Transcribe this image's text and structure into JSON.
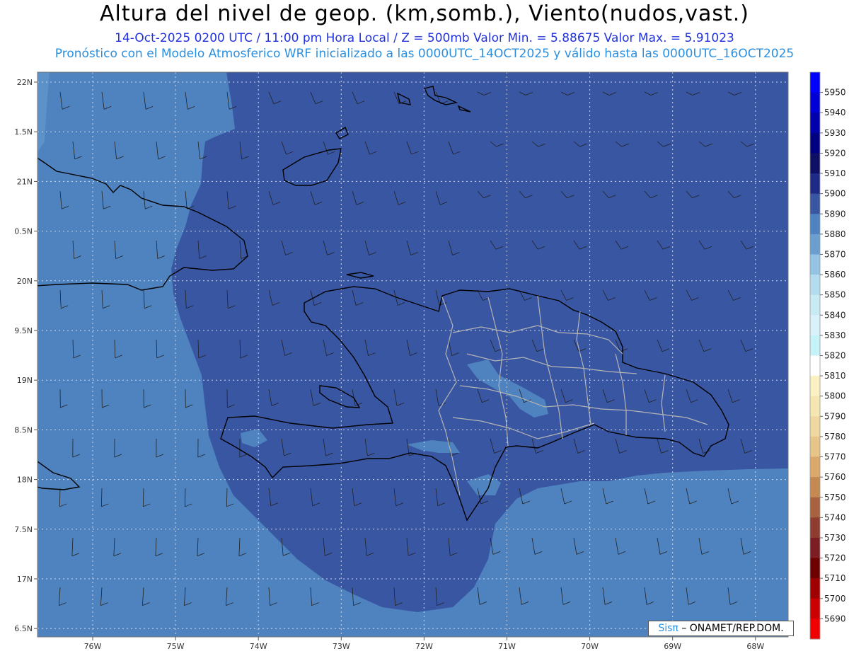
{
  "header": {
    "title": "Altura del nivel de geop. (km,somb.), Viento(nudos,vast.)",
    "line1": "14-Oct-2025  0200 UTC / 11:00 pm Hora Local / Z = 500mb     Valor Min. = 5.88675   Valor Max. = 5.91023",
    "line2": "Pronóstico con el Modelo Atmosferico WRF inicializado a las 0000UTC_14OCT2025 y válido hasta las  0000UTC_16OCT2025"
  },
  "map": {
    "lat_labels": [
      "22N",
      "1.5N",
      "21N",
      "0.5N",
      "20N",
      "9.5N",
      "19N",
      "8.5N",
      "18N",
      "7.5N",
      "17N",
      "6.5N"
    ],
    "lon_labels": [
      "76W",
      "75W",
      "74W",
      "73W",
      "72W",
      "71W",
      "70W",
      "69W",
      "68W"
    ],
    "colors": {
      "band_5890": "#4f83bf",
      "band_5900": "#3956a3",
      "band_5880": "#6a9fd0",
      "coast": "#000000",
      "provinces": "#b4b4b4",
      "grid": "#cfd6e8"
    }
  },
  "colorbar": {
    "levels": [
      "5950",
      "5940",
      "5930",
      "5920",
      "5910",
      "5900",
      "5890",
      "5880",
      "5870",
      "5860",
      "5850",
      "5840",
      "5830",
      "5820",
      "5810",
      "5800",
      "5790",
      "5780",
      "5770",
      "5760",
      "5750",
      "5740",
      "5730",
      "5720",
      "5710",
      "5700",
      "5690"
    ],
    "colors": [
      "#0000ff",
      "#0000d6",
      "#0000ac",
      "#000082",
      "#0f0f66",
      "#1d2b86",
      "#3956a3",
      "#4f83bf",
      "#6a9fd0",
      "#95c3e3",
      "#b3dcef",
      "#c7eaf5",
      "#d9f2fa",
      "#c6f3f7",
      "#fff",
      "#fbf0c2",
      "#f5e6b2",
      "#efd8a0",
      "#e7c487",
      "#d9a86a",
      "#c48a52",
      "#a8623f",
      "#8e3b30",
      "#7d1e24",
      "#6f0000",
      "#a00000",
      "#cc0000",
      "#f00000"
    ]
  },
  "credit": {
    "sis": "Sisπ",
    "rest": "– ONAMET/REP.DOM."
  }
}
